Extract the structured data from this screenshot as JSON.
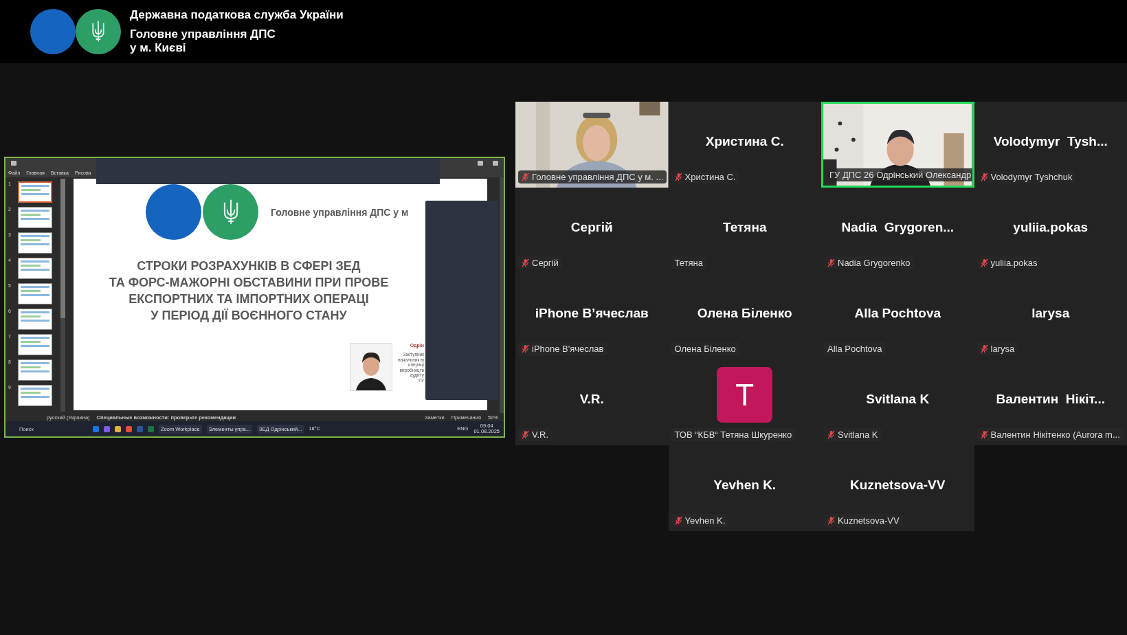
{
  "header": {
    "title": "Державна податкова служба України",
    "subtitle_lines": [
      "Головне управління ДПС",
      "у м. Києві"
    ]
  },
  "shared_screen": {
    "ribbon_tabs": [
      "Файл",
      "Главная",
      "Вставка",
      "Рисова"
    ],
    "thumbnails": [
      {
        "number": "1",
        "selected": true
      },
      {
        "number": "2",
        "selected": false
      },
      {
        "number": "3",
        "selected": false
      },
      {
        "number": "4",
        "selected": false
      },
      {
        "number": "5",
        "selected": false
      },
      {
        "number": "6",
        "selected": false
      },
      {
        "number": "7",
        "selected": false
      },
      {
        "number": "8",
        "selected": false
      },
      {
        "number": "9",
        "selected": false
      }
    ],
    "slide": {
      "org": "Головне управління ДПС у м",
      "title_lines": [
        "СТРОКИ РОЗРАХУНКІВ В СФЕРІ ЗЕД",
        "ТА ФОРС-МАЖОРНІ ОБСТАВИНИ ПРИ ПРОВЕ",
        "ЕКСПОРТНИХ ТА ІМПОРТНИХ ОПЕРАЦІ",
        "У ПЕРІОД ДІЇ ВОЄННОГО СТАНУ"
      ],
      "speaker_name": "Одрін",
      "speaker_lines": [
        "Заступник",
        "начальник ві",
        "операці",
        "виробництв",
        "аудиту",
        "ГУ"
      ]
    },
    "status_bar": {
      "language": "русский (Украина)",
      "accessibility": "Специальные возможности: проверьте рекомендации",
      "notes": "Заметки",
      "comments": "Примечания",
      "zoom": "50%"
    },
    "taskbar": {
      "search": "Поиск",
      "apps": [
        {
          "label": "Zoom Workplace"
        },
        {
          "label": "Элементы упра..."
        },
        {
          "label": "ЗЕД Одрінський..."
        }
      ],
      "weather": "18°C",
      "language": "ENG",
      "time": "09:04",
      "date": "01.08.2025"
    }
  },
  "participants": [
    {
      "kind": "video",
      "label": "Головне управління ДПС у м. ...",
      "muted": true,
      "active": false
    },
    {
      "kind": "name",
      "name": "Христина С.",
      "label": "Христина С.",
      "muted": true,
      "active": false
    },
    {
      "kind": "video",
      "label": "ГУ ДПС 26 Одрінський Олександр",
      "muted": false,
      "active": true
    },
    {
      "kind": "name",
      "name": "Volodymyr  Tysh...",
      "label": "Volodymyr Tyshchuk",
      "muted": true,
      "active": false
    },
    {
      "kind": "name",
      "name": "Сергій",
      "label": "Сергій",
      "muted": true,
      "active": false
    },
    {
      "kind": "name",
      "name": "Тетяна",
      "label": "Тетяна",
      "muted": false,
      "active": false
    },
    {
      "kind": "name",
      "name": "Nadia  Grygoren...",
      "label": "Nadia Grygorenko",
      "muted": true,
      "active": false
    },
    {
      "kind": "name",
      "name": "yuliia.pokas",
      "label": "yuliia.pokas",
      "muted": true,
      "active": false
    },
    {
      "kind": "name",
      "name": "iPhone В’ячеслав",
      "label": "iPhone В'ячеслав",
      "muted": true,
      "active": false
    },
    {
      "kind": "name",
      "name": "Олена Біленко",
      "label": "Олена Біленко",
      "muted": false,
      "active": false
    },
    {
      "kind": "name",
      "name": "Alla Pochtova",
      "label": "Alla Pochtova",
      "muted": false,
      "active": false
    },
    {
      "kind": "name",
      "name": "larysa",
      "label": "larysa",
      "muted": true,
      "active": false
    },
    {
      "kind": "name",
      "name": "V.R.",
      "label": "V.R.",
      "muted": true,
      "active": false
    },
    {
      "kind": "avatar",
      "avatar_letter": "T",
      "label": "ТОВ “КБВ“ Тетяна Шкуренко",
      "muted": false,
      "active": false
    },
    {
      "kind": "name",
      "name": "Svitlana K",
      "label": "Svitlana K",
      "muted": true,
      "active": false
    },
    {
      "kind": "name",
      "name": "Валентин  Нікіт...",
      "label": "Валентин Нікітенко (Aurora m...",
      "muted": true,
      "active": false
    },
    {
      "kind": "name",
      "name": "Yevhen K.",
      "label": "Yevhen K.",
      "muted": true,
      "active": false
    },
    {
      "kind": "name",
      "name": "Kuznetsova-VV",
      "label": "Kuznetsova-VV",
      "muted": true,
      "active": false
    }
  ]
}
